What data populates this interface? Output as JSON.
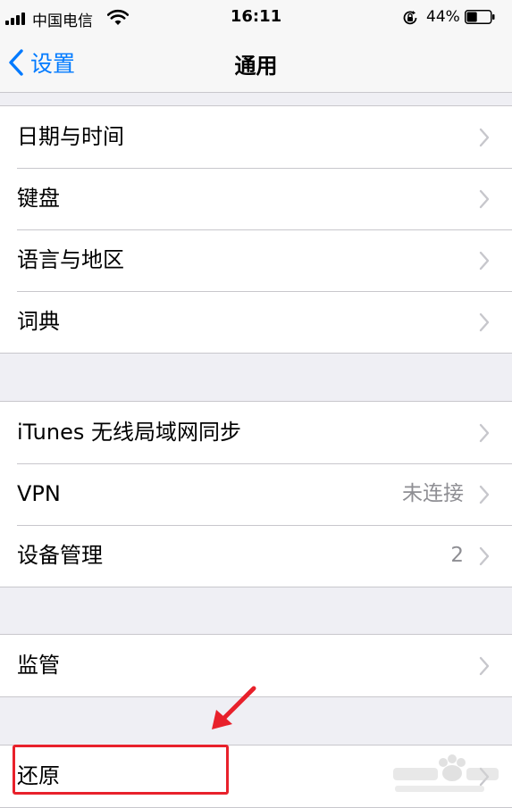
{
  "status_bar": {
    "carrier": "中国电信",
    "time": "16:11",
    "battery_percent": "44%",
    "battery_level": 0.44,
    "icons": [
      "signal-icon",
      "wifi-icon",
      "orientation-lock-icon",
      "battery-icon"
    ]
  },
  "nav": {
    "back_label": "设置",
    "title": "通用"
  },
  "groups": [
    {
      "rows": [
        {
          "label": "日期与时间",
          "value": ""
        },
        {
          "label": "键盘",
          "value": ""
        },
        {
          "label": "语言与地区",
          "value": ""
        },
        {
          "label": "词典",
          "value": ""
        }
      ]
    },
    {
      "rows": [
        {
          "label": "iTunes 无线局域网同步",
          "value": ""
        },
        {
          "label": "VPN",
          "value": "未连接"
        },
        {
          "label": "设备管理",
          "value": "2"
        }
      ]
    },
    {
      "rows": [
        {
          "label": "监管",
          "value": ""
        }
      ]
    },
    {
      "rows": [
        {
          "label": "还原",
          "value": ""
        }
      ]
    }
  ],
  "annotation": {
    "highlight_color": "#e8212b"
  },
  "colors": {
    "accent": "#007aff",
    "background": "#efeff4",
    "separator": "#c8c7cc",
    "secondary_text": "#8e8e93"
  }
}
